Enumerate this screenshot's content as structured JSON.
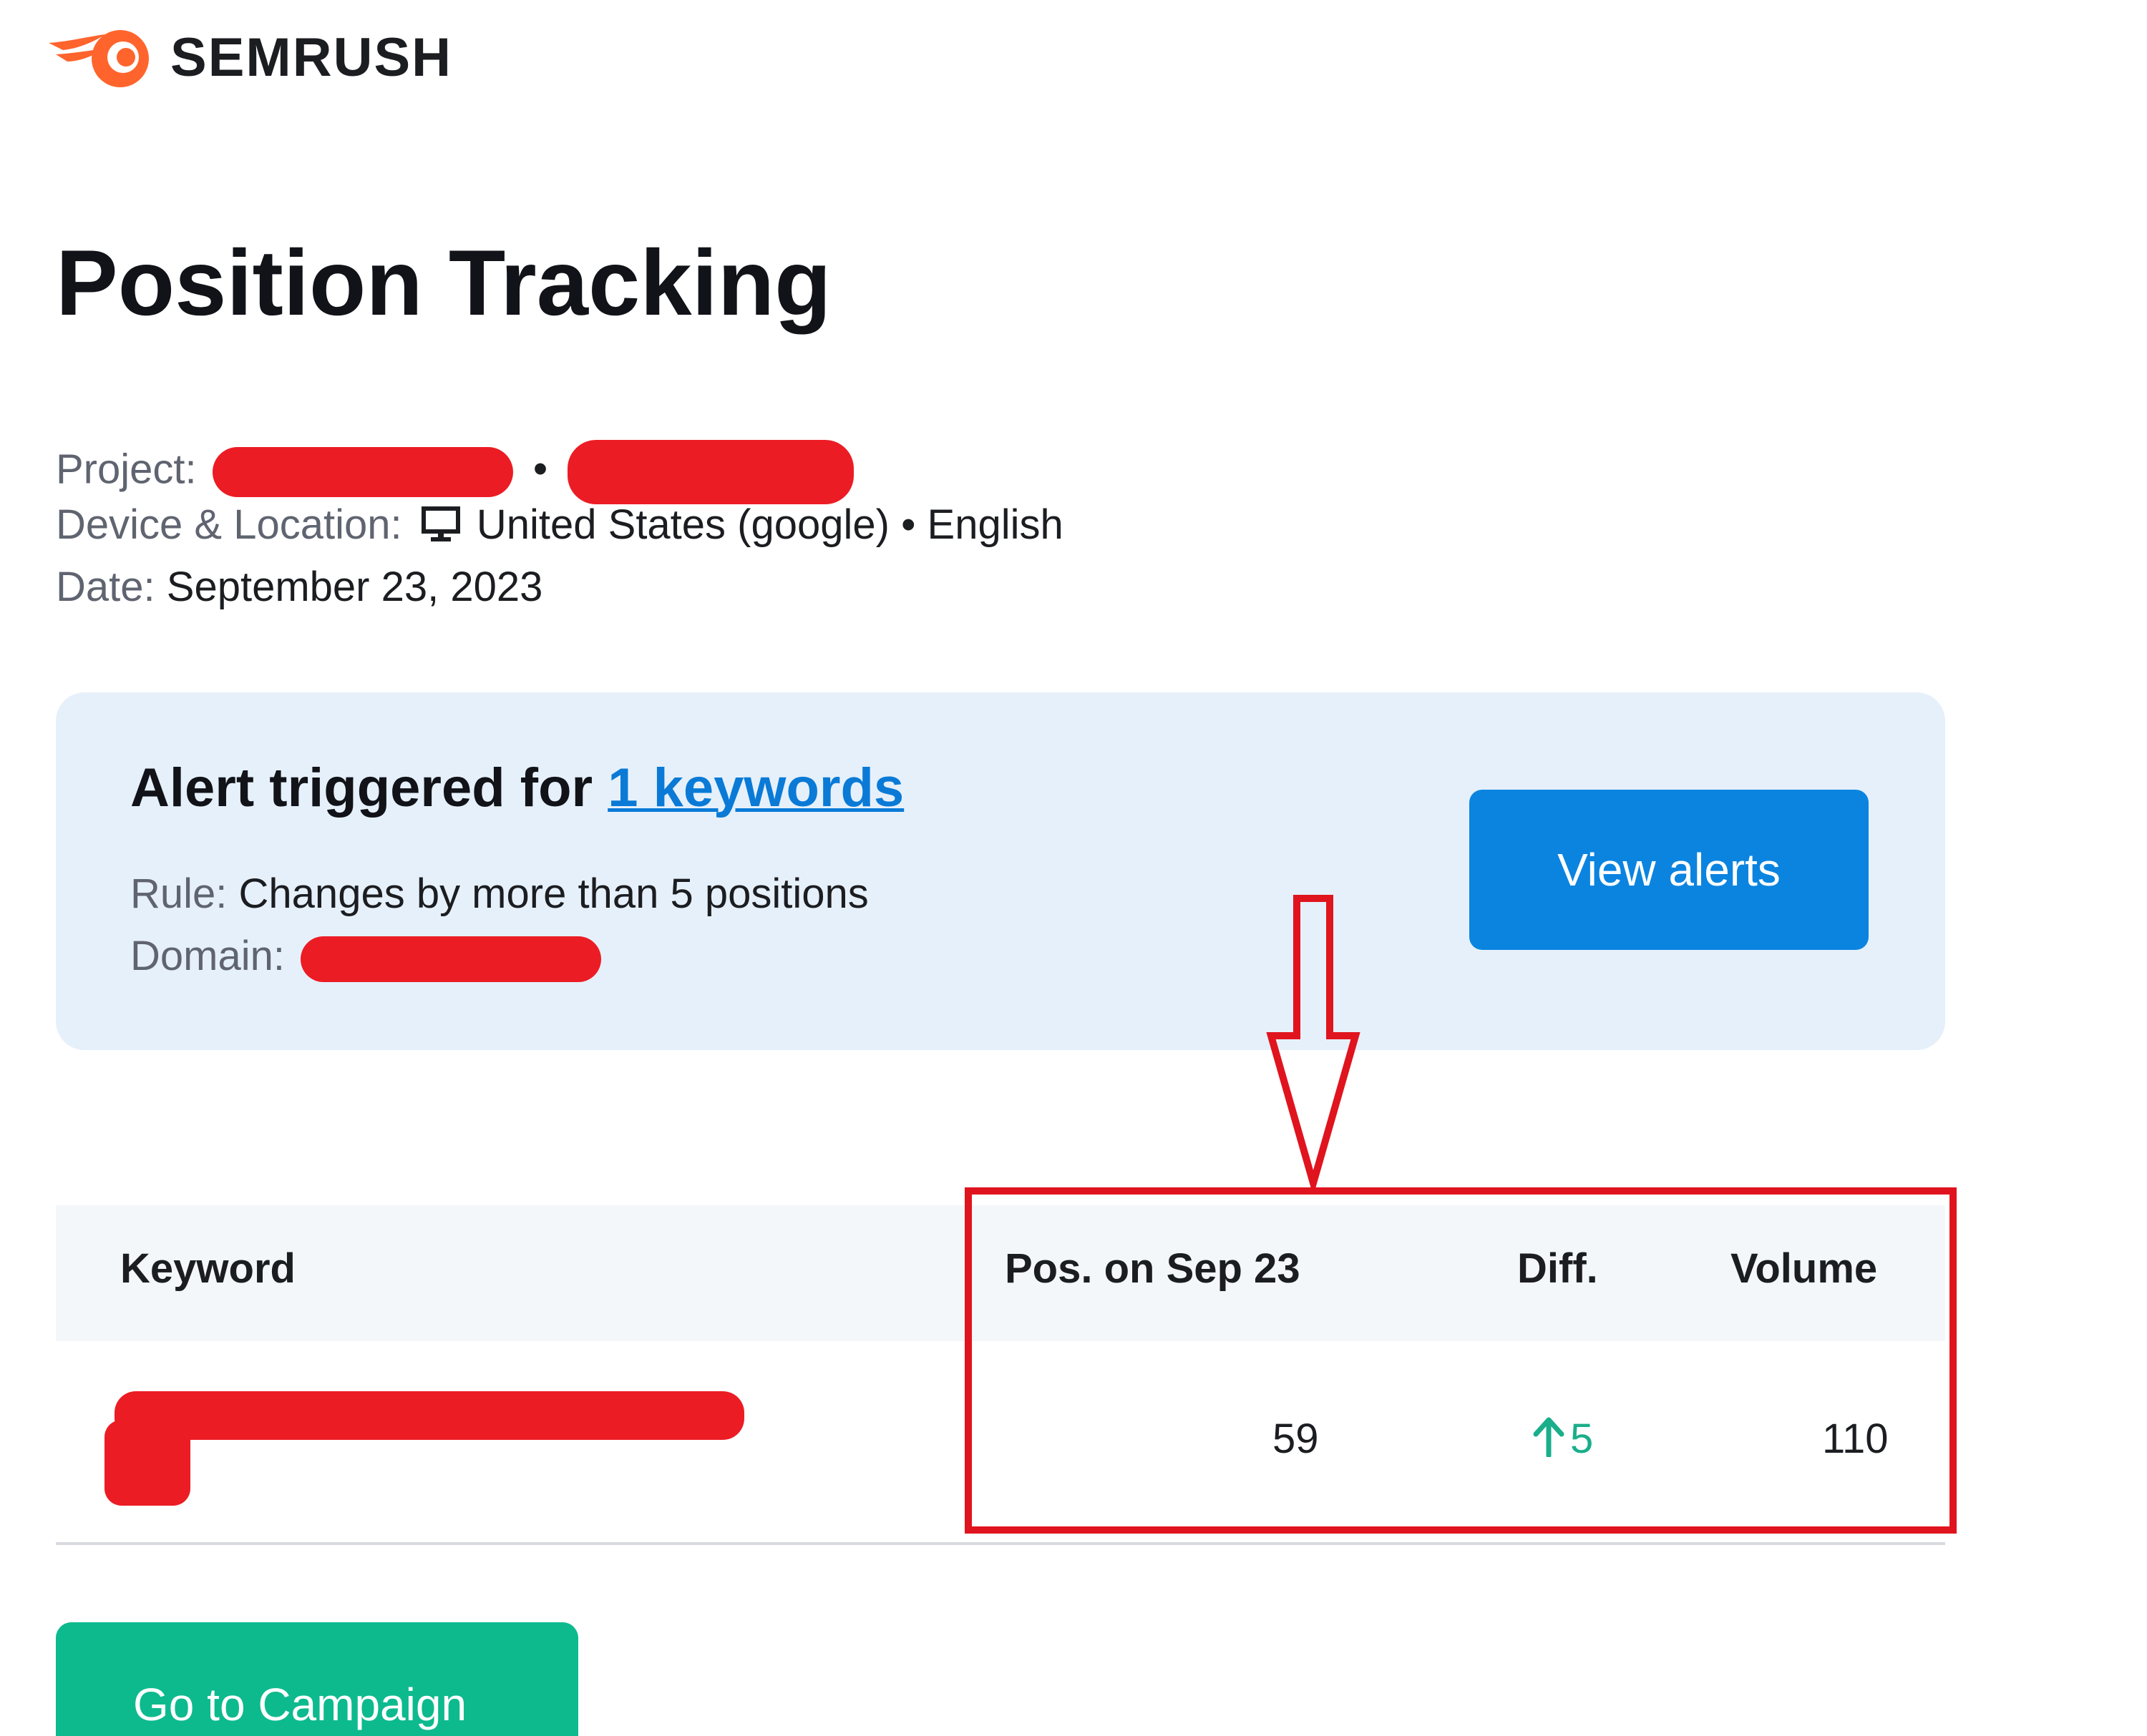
{
  "brand": {
    "name": "SEMRUSH",
    "logo_icon": "semrush-flame-logo",
    "accent": "#ff642d"
  },
  "header": {
    "title": "Position Tracking"
  },
  "meta": {
    "project_label": "Project:",
    "device_label": "Device & Location:",
    "device_icon": "monitor-icon",
    "device_value": "United States (google) • English",
    "date_label": "Date:",
    "date_value": "September 23, 2023"
  },
  "alert": {
    "title_prefix": "Alert triggered for ",
    "title_link": "1 keywords",
    "rule_label": "Rule:",
    "rule_value": "Changes by more than 5 positions",
    "domain_label": "Domain:",
    "button_label": "View alerts",
    "bg_color": "#e6f0fa",
    "button_color": "#0b84e0"
  },
  "table": {
    "columns": [
      "Keyword",
      "Pos. on Sep 23",
      "Diff.",
      "Volume"
    ],
    "rows": [
      {
        "position": "59",
        "diff": "5",
        "diff_direction": "up",
        "volume": "110"
      }
    ],
    "diff_color": "#1aae8a"
  },
  "actions": {
    "campaign_button_label": "Go to Campaign",
    "campaign_button_color": "#0cba8e"
  },
  "annotation_color": "#e0141e"
}
